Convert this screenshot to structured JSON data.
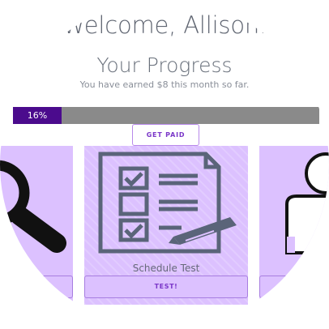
{
  "header": {
    "welcome": "Welcome, Allison.",
    "progress_title": "Your Progress",
    "earned_text": "You have earned $8 this month so far."
  },
  "progress": {
    "value": 0.16,
    "label": "16%"
  },
  "actions": {
    "get_paid_label": "GET PAID"
  },
  "cards": [
    {
      "label": "",
      "icon": "magnifying-glass-icon"
    },
    {
      "label": "Schedule Test",
      "button_label": "TEST!",
      "icon": "checklist-icon"
    },
    {
      "label": "",
      "icon": "person-icon"
    }
  ],
  "colors": {
    "accent": "#4b0b8d",
    "card_bg": "#dcc1ff",
    "button_text": "#7a36c8",
    "track": "#8a8a8a"
  }
}
